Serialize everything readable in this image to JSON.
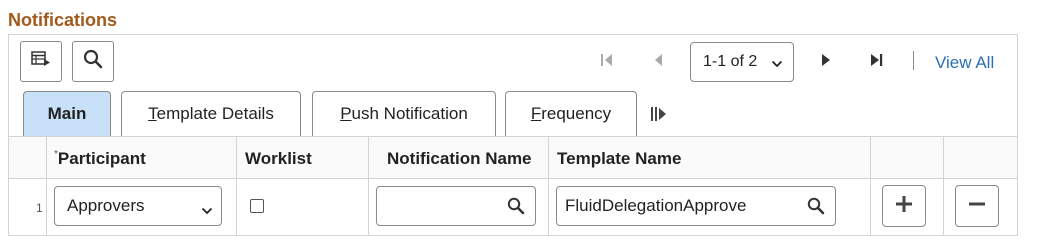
{
  "section_title": "Notifications",
  "toolbar": {
    "personalize_icon": "grid-personalize-icon",
    "find_icon": "search-icon"
  },
  "pager": {
    "first_icon": "first-page-icon",
    "prev_icon": "previous-page-icon",
    "range_label": "1-1 of 2",
    "next_icon": "next-page-icon",
    "last_icon": "last-page-icon",
    "view_all_label": "View All"
  },
  "tabs": [
    {
      "label": "Main",
      "active": true
    },
    {
      "label": "Template Details",
      "accesskey": "T",
      "rest": "emplate Details"
    },
    {
      "label": "Push Notification",
      "accesskey": "P",
      "rest": "ush Notification"
    },
    {
      "label": "Frequency",
      "accesskey": "F",
      "rest": "requency"
    }
  ],
  "show_all_tabs_icon": "show-all-columns-icon",
  "columns": {
    "required_marker": "*",
    "participant": "Participant",
    "worklist": "Worklist",
    "notification_name": "Notification Name",
    "template_name": "Template Name"
  },
  "rows": [
    {
      "row_number": "1",
      "participant": "Approvers",
      "worklist_checked": false,
      "notification_name": "",
      "template_name": "FluidDelegationApprove"
    }
  ],
  "colors": {
    "title": "#a1591c",
    "active_tab": "#c8e1f8",
    "link": "#2a6fb3"
  }
}
